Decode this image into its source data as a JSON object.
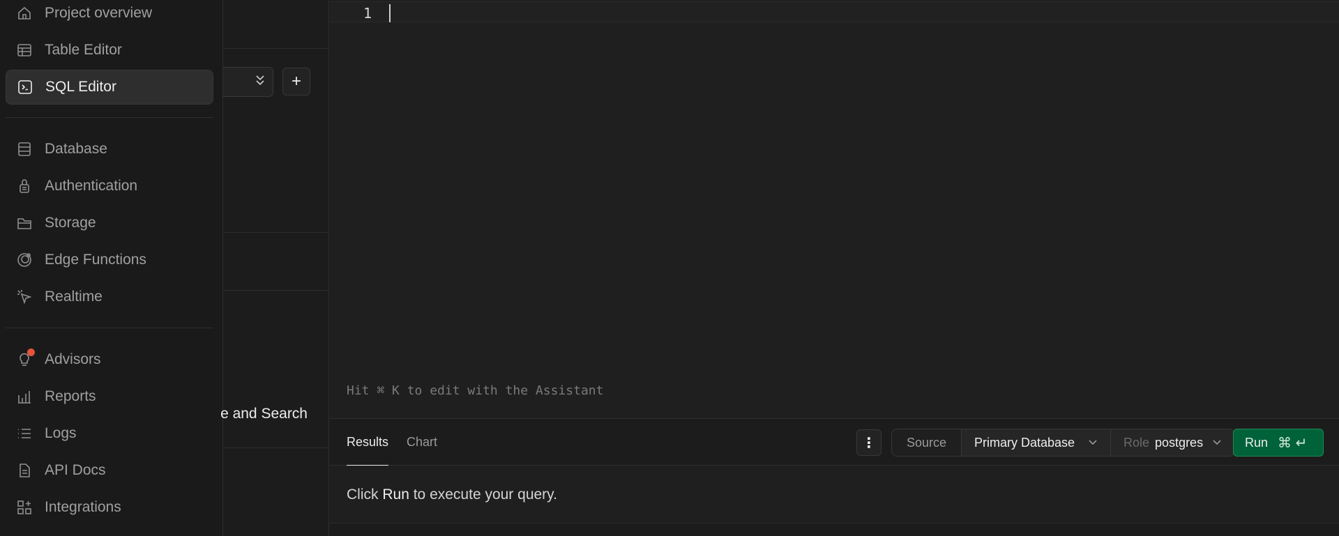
{
  "nav": {
    "items": [
      {
        "label": "Project overview",
        "icon": "home-icon"
      },
      {
        "label": "Table Editor",
        "icon": "table-icon"
      },
      {
        "label": "SQL Editor",
        "icon": "terminal-icon",
        "active": true
      },
      {
        "label": "Database",
        "icon": "database-icon"
      },
      {
        "label": "Authentication",
        "icon": "lock-icon"
      },
      {
        "label": "Storage",
        "icon": "folder-icon"
      },
      {
        "label": "Edge Functions",
        "icon": "edge-functions-icon"
      },
      {
        "label": "Realtime",
        "icon": "cursor-icon"
      },
      {
        "label": "Advisors",
        "icon": "lightbulb-icon"
      },
      {
        "label": "Reports",
        "icon": "chart-icon"
      },
      {
        "label": "Logs",
        "icon": "list-icon"
      },
      {
        "label": "API Docs",
        "icon": "document-icon"
      },
      {
        "label": "Integrations",
        "icon": "grid-plus-icon"
      }
    ]
  },
  "panel": {
    "plus_label": "+",
    "partial_text": "e and Search"
  },
  "editor": {
    "line_number": "1",
    "hint": "Hit ⌘ K to edit with the Assistant"
  },
  "results": {
    "tab_results": "Results",
    "tab_chart": "Chart",
    "source_label": "Source",
    "database_value": "Primary Database",
    "role_label": "Role",
    "role_value": "postgres",
    "run_label": "Run",
    "run_shortcut": "⌘ ↵",
    "message_prefix": "Click",
    "message_run": "Run",
    "message_suffix": "to execute your query."
  },
  "colors": {
    "accent_green": "#006239",
    "badge_red": "#e5533d"
  }
}
